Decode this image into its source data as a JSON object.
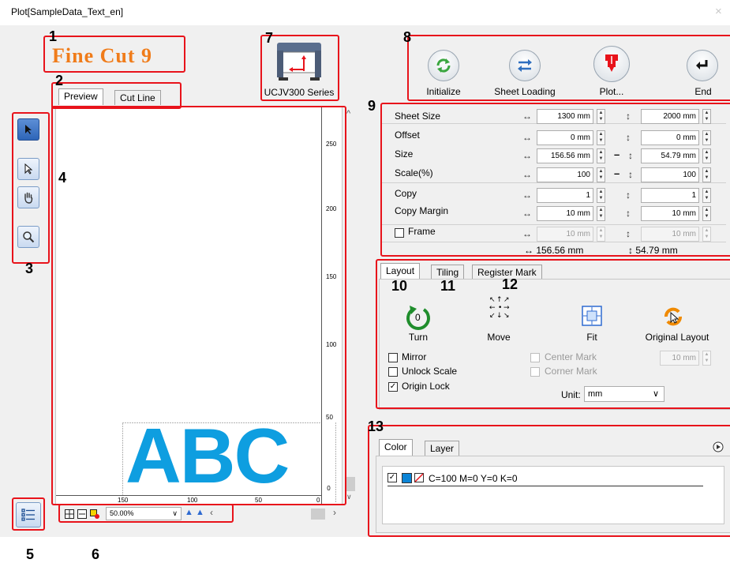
{
  "window": {
    "title": "Plot[SampleData_Text_en]",
    "close_glyph": "×"
  },
  "logo": {
    "text": "Fine Cut 9"
  },
  "printer": {
    "name": "UCJV300 Series"
  },
  "preview_tabs": [
    {
      "label": "Preview"
    },
    {
      "label": "Cut Line"
    }
  ],
  "tools": [
    {
      "icon": "arrow-select-icon"
    },
    {
      "icon": "node-select-icon"
    },
    {
      "icon": "hand-pan-icon"
    },
    {
      "icon": "zoom-icon"
    }
  ],
  "canvas": {
    "artwork_text": "ABC",
    "ruler_v": [
      "250",
      "200",
      "150",
      "100",
      "50",
      "0"
    ],
    "ruler_h": [
      "150",
      "100",
      "50",
      "0"
    ],
    "zoom": "50.00%"
  },
  "actions": [
    {
      "label": "Initialize",
      "icon": "initialize-icon"
    },
    {
      "label": "Sheet Loading",
      "icon": "sheet-loading-icon"
    },
    {
      "label": "Plot...",
      "icon": "plot-icon"
    },
    {
      "label": "End",
      "icon": "end-icon"
    }
  ],
  "params": {
    "sheet_size": {
      "label": "Sheet Size",
      "w": "1300 mm",
      "h": "2000 mm"
    },
    "offset": {
      "label": "Offset",
      "w": "0 mm",
      "h": "0 mm"
    },
    "size": {
      "label": "Size",
      "w": "156.56 mm",
      "h": "54.79 mm"
    },
    "scale": {
      "label": "Scale(%)",
      "w": "100",
      "h": "100"
    },
    "copy": {
      "label": "Copy",
      "w": "1",
      "h": "1"
    },
    "copy_margin": {
      "label": "Copy Margin",
      "w": "10 mm",
      "h": "10 mm"
    },
    "frame": {
      "label": "Frame",
      "w": "10 mm",
      "h": "10 mm",
      "checked": false
    },
    "summary_w": "↔ 156.56 mm",
    "summary_h": "↕ 54.79 mm",
    "horiz_arrow": "↔",
    "vert_arrow": "↕",
    "link_dash": "–"
  },
  "layout_tabs": [
    {
      "label": "Layout"
    },
    {
      "label": "Tiling"
    },
    {
      "label": "Register Mark"
    }
  ],
  "layout": {
    "turn": {
      "label": "Turn",
      "value": "0"
    },
    "move": {
      "label": "Move"
    },
    "fit": {
      "label": "Fit"
    },
    "original": {
      "label": "Original Layout"
    },
    "mirror": {
      "label": "Mirror",
      "checked": false
    },
    "unlock_scale": {
      "label": "Unlock Scale",
      "checked": false
    },
    "origin_lock": {
      "label": "Origin Lock",
      "checked": true
    },
    "center_mark": {
      "label": "Center Mark",
      "checked": false
    },
    "corner_mark": {
      "label": "Corner Mark",
      "checked": false
    },
    "mark_margin": "10 mm",
    "unit_label": "Unit:",
    "unit_value": "mm"
  },
  "color_tabs": [
    {
      "label": "Color"
    },
    {
      "label": "Layer"
    }
  ],
  "color_list": [
    {
      "text": "C=100 M=0 Y=0 K=0",
      "checked": true,
      "swatch": "#0b84d6"
    }
  ],
  "callouts": [
    "1",
    "2",
    "3",
    "4",
    "5",
    "6",
    "7",
    "8",
    "9",
    "10",
    "11",
    "12",
    "13"
  ],
  "colors": {
    "accent_red": "#e8131b",
    "cyan": "#0e9ee0",
    "logo_orange": "#f07c1a",
    "green": "#3aa640"
  }
}
